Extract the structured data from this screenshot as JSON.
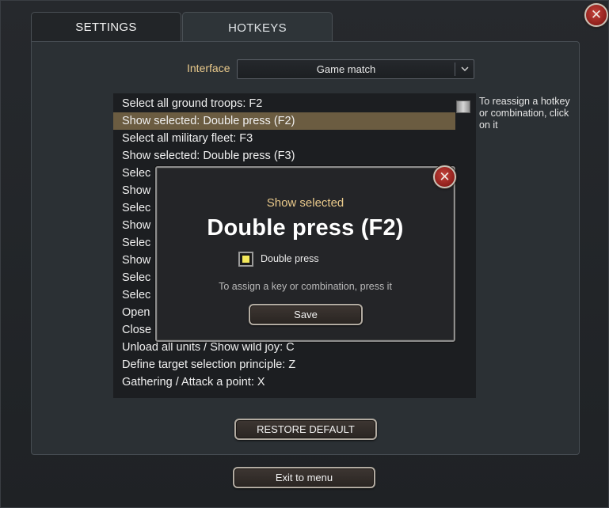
{
  "tabs": [
    {
      "label": "SETTINGS",
      "active": false
    },
    {
      "label": "HOTKEYS",
      "active": true
    }
  ],
  "interface": {
    "label": "Interface",
    "selected": "Game match"
  },
  "hotkeys": [
    {
      "text": "Select all ground troops: F2",
      "selected": false
    },
    {
      "text": "Show selected: Double press (F2)",
      "selected": true
    },
    {
      "text": "Select all military fleet: F3",
      "selected": false
    },
    {
      "text": "Show selected: Double press (F3)",
      "selected": false
    },
    {
      "text": "Selec",
      "selected": false
    },
    {
      "text": "Show",
      "selected": false
    },
    {
      "text": "Selec",
      "selected": false
    },
    {
      "text": "Show",
      "selected": false
    },
    {
      "text": "Selec",
      "selected": false
    },
    {
      "text": "Show",
      "selected": false
    },
    {
      "text": "Selec",
      "selected": false
    },
    {
      "text": "Selec",
      "selected": false
    },
    {
      "text": "Open",
      "selected": false
    },
    {
      "text": "Close",
      "selected": false
    },
    {
      "text": "Unload all units / Show wild joy: C",
      "selected": false
    },
    {
      "text": "Define target selection principle: Z",
      "selected": false
    },
    {
      "text": "Gathering / Attack a point: X",
      "selected": false
    }
  ],
  "hint": "To reassign a hotkey or combination, click on it",
  "buttons": {
    "restore": "RESTORE DEFAULT",
    "exit": "Exit to menu"
  },
  "modal": {
    "subtitle": "Show selected",
    "title": "Double press (F2)",
    "checkbox_label": "Double press",
    "checkbox_checked": true,
    "instruction": "To assign a key or combination, press it",
    "save": "Save"
  },
  "icons": {
    "close": "close-icon",
    "dropdown": "chevron-down-icon"
  },
  "colors": {
    "accent_gold": "#e9c98b",
    "selected_row": "#6b5c41",
    "close_red": "#a52a24",
    "checkbox_yellow": "#f3e85a"
  }
}
